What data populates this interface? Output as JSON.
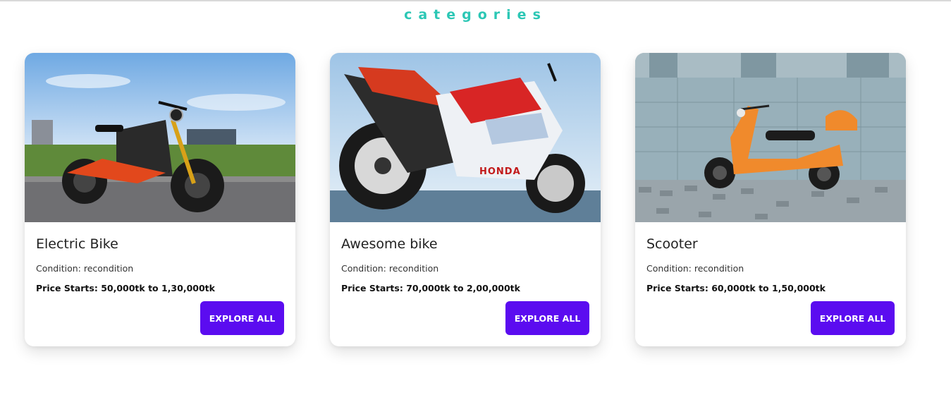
{
  "section": {
    "title": "categories",
    "accent_color": "#2cc7b5"
  },
  "cards": [
    {
      "image_alt": "Electric Bike",
      "title": "Electric Bike",
      "condition": "Condition: recondition",
      "price": "Price Starts: 50,000tk to 1,30,000tk",
      "button_label": "EXPLORE ALL"
    },
    {
      "image_alt": "Awesome bike",
      "title": "Awesome bike",
      "condition": "Condition: recondition",
      "price": "Price Starts: 70,000tk to 2,00,000tk",
      "button_label": "EXPLORE ALL"
    },
    {
      "image_alt": "Scooter",
      "title": "Scooter",
      "condition": "Condition: recondition",
      "price": "Price Starts: 60,000tk to 1,50,000tk",
      "button_label": "EXPLORE ALL"
    }
  ],
  "colors": {
    "button": "#5b0cf0",
    "button_text": "#ffffff"
  }
}
